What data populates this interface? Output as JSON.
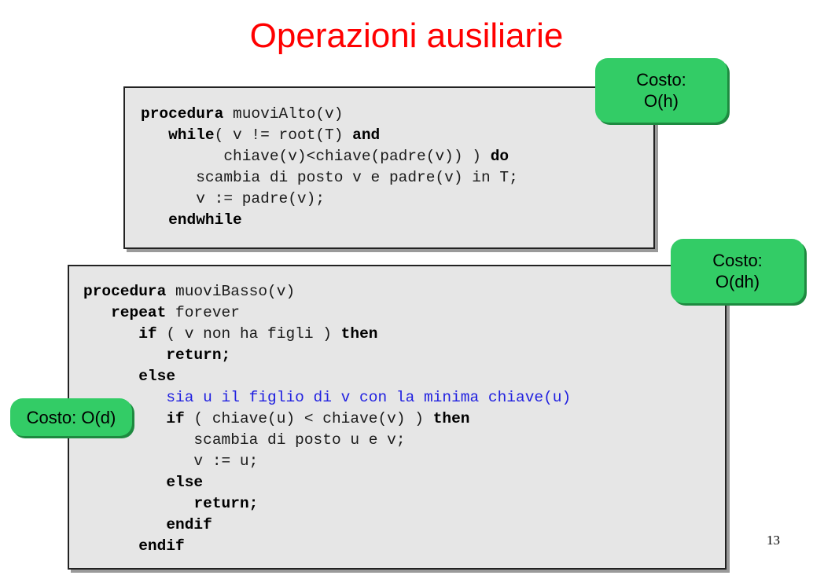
{
  "slide": {
    "title": "Operazioni ausiliarie",
    "page_number": "13"
  },
  "procedure_up": {
    "lines": [
      [
        {
          "t": "procedura",
          "b": true
        },
        {
          "t": " muoviAlto(v)"
        }
      ],
      [
        {
          "t": "   "
        },
        {
          "t": "while",
          "b": true
        },
        {
          "t": "( v != root(T) "
        },
        {
          "t": "and",
          "b": true
        }
      ],
      [
        {
          "t": "         chiave(v)<chiave(padre(v)) ) "
        },
        {
          "t": "do",
          "b": true
        }
      ],
      [
        {
          "t": "      scambia di posto v e padre(v) in T;"
        }
      ],
      [
        {
          "t": "      v := padre(v);"
        }
      ],
      [
        {
          "t": "   "
        },
        {
          "t": "endwhile",
          "b": true
        }
      ]
    ]
  },
  "procedure_down": {
    "lines": [
      [
        {
          "t": "procedura",
          "b": true
        },
        {
          "t": " muoviBasso(v)"
        }
      ],
      [
        {
          "t": "   "
        },
        {
          "t": "repeat",
          "b": true
        },
        {
          "t": " forever"
        }
      ],
      [
        {
          "t": "      "
        },
        {
          "t": "if",
          "b": true
        },
        {
          "t": " ( v non ha figli ) "
        },
        {
          "t": "then",
          "b": true
        }
      ],
      [
        {
          "t": "         "
        },
        {
          "t": "return;",
          "b": true
        }
      ],
      [
        {
          "t": "      "
        },
        {
          "t": "else",
          "b": true
        }
      ],
      [
        {
          "t": "         sia u il figlio di v con la minima chiave(u)",
          "blue": true
        }
      ],
      [
        {
          "t": "         "
        },
        {
          "t": "if",
          "b": true
        },
        {
          "t": " ( chiave(u) < chiave(v) ) "
        },
        {
          "t": "then",
          "b": true
        }
      ],
      [
        {
          "t": "            scambia di posto u e v;"
        }
      ],
      [
        {
          "t": "            v := u;"
        }
      ],
      [
        {
          "t": "         "
        },
        {
          "t": "else",
          "b": true
        }
      ],
      [
        {
          "t": "            "
        },
        {
          "t": "return;",
          "b": true
        }
      ],
      [
        {
          "t": "         "
        },
        {
          "t": "endif",
          "b": true
        }
      ],
      [
        {
          "t": "      "
        },
        {
          "t": "endif",
          "b": true
        }
      ]
    ]
  },
  "callouts": {
    "up": {
      "line1": "Costo:",
      "line2": "O(h)"
    },
    "down": {
      "line1": "Costo:",
      "line2": "O(dh)"
    },
    "child": {
      "line1": "Costo: O(d)"
    }
  },
  "colors": {
    "title": "#ff0000",
    "callout_fill": "#33cc66",
    "code_box_fill": "#e6e6e6",
    "highlight_text": "#2020e0"
  }
}
